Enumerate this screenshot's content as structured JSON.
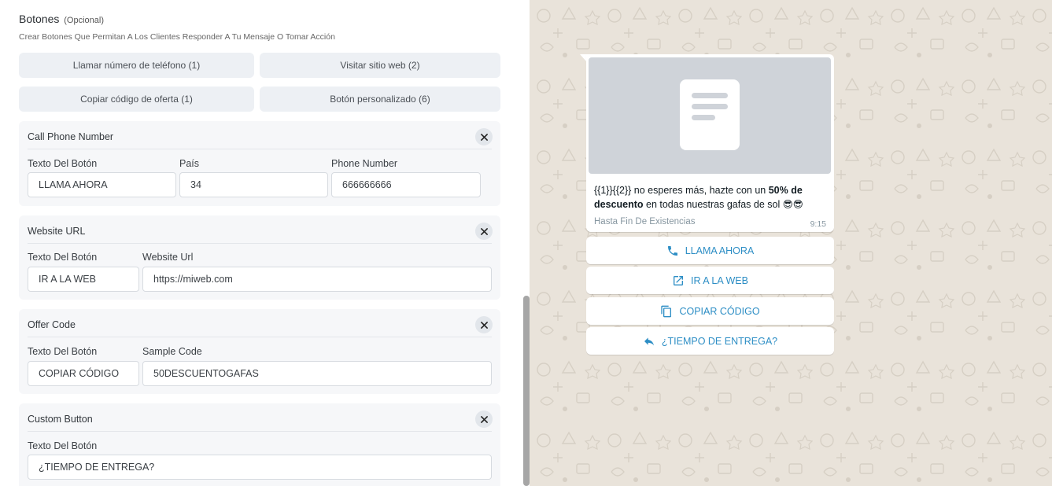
{
  "buttons_section": {
    "title": "Botones",
    "optional": "(Opcional)",
    "subtitle": "Crear Botones Que Permitan A Los Clientes Responder A Tu Mensaje O Tomar Acción",
    "add_buttons": {
      "call_phone": "Llamar número de teléfono (1)",
      "visit_web": "Visitar sitio web (2)",
      "copy_code": "Copiar código de oferta (1)",
      "custom": "Botón personalizado (6)"
    }
  },
  "cards": {
    "call": {
      "title": "Call Phone Number",
      "text_label": "Texto Del Botón",
      "text_value": "LLAMA AHORA",
      "country_label": "País",
      "country_value": "34",
      "phone_label": "Phone Number",
      "phone_value": "666666666"
    },
    "website": {
      "title": "Website URL",
      "text_label": "Texto Del Botón",
      "text_value": "IR A LA WEB",
      "url_label": "Website Url",
      "url_value": "https://miweb.com"
    },
    "offer": {
      "title": "Offer Code",
      "text_label": "Texto Del Botón",
      "text_value": "COPIAR CÓDIGO",
      "code_label": "Sample Code",
      "code_value": "50DESCUENTOGAFAS"
    },
    "custom": {
      "title": "Custom Button",
      "text_label": "Texto Del Botón",
      "text_value": "¿TIEMPO DE ENTREGA?"
    }
  },
  "preview": {
    "msg_vars": "{{1}}{{2}}",
    "msg_part1": " no esperes más, hazte con un ",
    "msg_bold": "50% de descuento",
    "msg_part2": " en todas nuestras gafas de sol ",
    "msg_emoji": "😎😎",
    "footer": "Hasta Fin De Existencias",
    "time": "9:15",
    "buttons": {
      "call": "LLAMA AHORA",
      "web": "IR A LA WEB",
      "copy": "COPIAR CÓDIGO",
      "reply": "¿TIEMPO DE ENTREGA?"
    }
  },
  "colors": {
    "accent": "#2d8ec5",
    "chat_bg": "#e9e3da",
    "button_bg": "#edf0f4"
  }
}
